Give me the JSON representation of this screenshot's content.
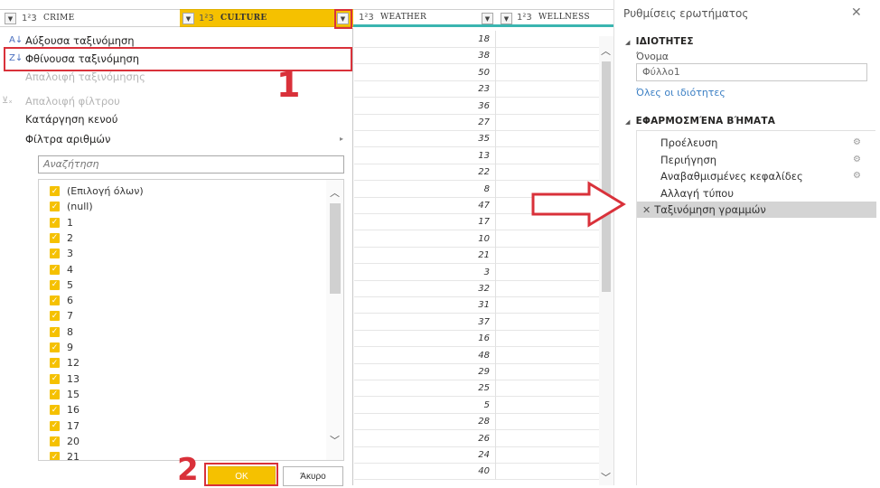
{
  "columns": {
    "crime": {
      "type": "1²3",
      "name": "CRIME"
    },
    "culture": {
      "type": "1²3",
      "name": "CULTURE"
    },
    "weather": {
      "type": "1²3",
      "name": "WEATHER"
    },
    "wellness": {
      "type": "1²3",
      "name": "WELLNESS"
    }
  },
  "menu": {
    "sort_ascending": "Αύξουσα ταξινόμηση",
    "sort_descending": "Φθίνουσα ταξινόμηση",
    "clear_sort": "Απαλοιφή ταξινόμησης",
    "clear_filter": "Απαλοιφή φίλτρου",
    "remove_empty": "Κατάργηση κενού",
    "number_filters": "Φίλτρα αριθμών",
    "search_placeholder": "Αναζήτηση",
    "items": [
      "(Επιλογή όλων)",
      "(null)",
      "1",
      "2",
      "3",
      "4",
      "5",
      "6",
      "7",
      "8",
      "9",
      "12",
      "13",
      "15",
      "16",
      "17",
      "20",
      "21"
    ],
    "ok_label": "OK",
    "cancel_label": "Άκυρο"
  },
  "weather_values": [
    "18",
    "38",
    "50",
    "23",
    "36",
    "27",
    "35",
    "13",
    "22",
    "8",
    "47",
    "17",
    "10",
    "21",
    "3",
    "32",
    "31",
    "37",
    "16",
    "48",
    "29",
    "25",
    "5",
    "28",
    "26",
    "24",
    "40"
  ],
  "panel": {
    "title": "Ρυθμίσεις ερωτήματος",
    "close": "✕",
    "properties_header": "ΙΔΙΟΤΗΤΕΣ",
    "name_label": "Όνομα",
    "name_value": "Φύλλο1",
    "all_properties": "Όλες οι ιδιότητες",
    "applied_steps_header": "ΕΦΑΡΜΟΣΜΈΝΑ ΒΉΜΑΤΑ",
    "steps": [
      "Προέλευση",
      "Περιήγηση",
      "Αναβαθμισμένες κεφαλίδες",
      "Αλλαγή τύπου",
      "Ταξινόμηση γραμμών"
    ]
  },
  "annotations": {
    "step1": "1",
    "step2": "2"
  },
  "colors": {
    "accent_red": "#d9313a",
    "culture_header": "#f5c100",
    "checkbox": "#f5c100"
  }
}
